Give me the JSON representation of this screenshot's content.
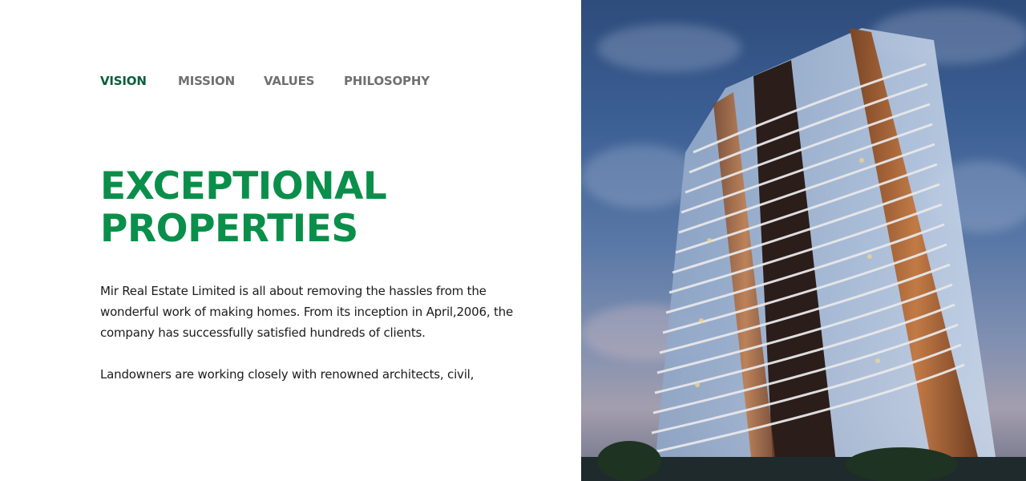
{
  "tabs": [
    {
      "label": "VISION",
      "active": true
    },
    {
      "label": "MISSION",
      "active": false
    },
    {
      "label": "VALUES",
      "active": false
    },
    {
      "label": "PHILOSOPHY",
      "active": false
    }
  ],
  "headline": {
    "line1": "EXCEPTIONAL",
    "line2": "PROPERTIES"
  },
  "paragraphs": [
    "Mir Real Estate Limited is all about removing the hassles from the wonderful work of making homes. From its inception in April,2006, the company has successfully satisfied hundreds of clients.",
    "Landowners are working closely with renowned architects, civil,"
  ],
  "colors": {
    "accent_green": "#0a8f4a",
    "active_tab": "#0b5e3a",
    "inactive_tab": "#707070"
  }
}
